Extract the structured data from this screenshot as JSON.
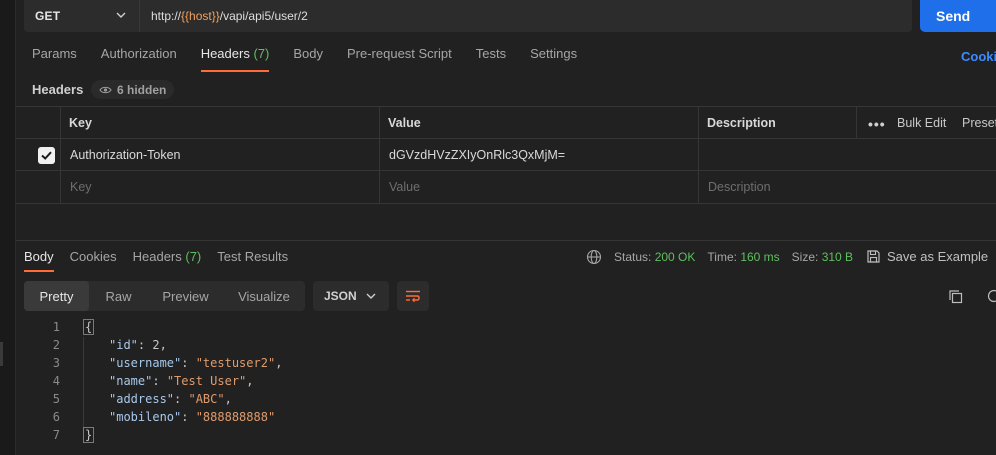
{
  "request": {
    "method": "GET",
    "url_prefix": "http://",
    "url_variable": "{{host}}",
    "url_suffix": "/vapi/api5/user/2",
    "send_label": "Send"
  },
  "request_tabs": [
    {
      "label": "Params"
    },
    {
      "label": "Authorization"
    },
    {
      "label": "Headers",
      "count": "(7)",
      "active": true
    },
    {
      "label": "Body"
    },
    {
      "label": "Pre-request Script"
    },
    {
      "label": "Tests"
    },
    {
      "label": "Settings"
    }
  ],
  "cookies_link": "Cooki",
  "headers_section": {
    "title": "Headers",
    "hidden_label": "6 hidden"
  },
  "headers_table": {
    "columns": [
      "Key",
      "Value",
      "Description"
    ],
    "bulk_edit": "Bulk Edit",
    "presets": "Preset",
    "rows": [
      {
        "checked": true,
        "key": "Authorization-Token",
        "value": "dGVzdHVzZXIyOnRlc3QxMjM=",
        "description": ""
      }
    ],
    "placeholder": {
      "key": "Key",
      "value": "Value",
      "description": "Description"
    }
  },
  "response_tabs": [
    {
      "label": "Body",
      "active": true
    },
    {
      "label": "Cookies"
    },
    {
      "label": "Headers",
      "count": "(7)"
    },
    {
      "label": "Test Results"
    }
  ],
  "response_status": {
    "status_label": "Status:",
    "status_value": "200 OK",
    "time_label": "Time:",
    "time_value": "160 ms",
    "size_label": "Size:",
    "size_value": "310 B",
    "save_example": "Save as Example"
  },
  "view_modes": [
    {
      "label": "Pretty",
      "active": true
    },
    {
      "label": "Raw"
    },
    {
      "label": "Preview"
    },
    {
      "label": "Visualize"
    }
  ],
  "format_select": "JSON",
  "code_lines": [
    {
      "num": "1",
      "text": "{"
    },
    {
      "num": "2",
      "key": "\"id\"",
      "sep": ": ",
      "value": "2",
      "type": "number",
      "trail": ","
    },
    {
      "num": "3",
      "key": "\"username\"",
      "sep": ": ",
      "value": "\"testuser2\"",
      "type": "string",
      "trail": ","
    },
    {
      "num": "4",
      "key": "\"name\"",
      "sep": ": ",
      "value": "\"Test User\"",
      "type": "string",
      "trail": ","
    },
    {
      "num": "5",
      "key": "\"address\"",
      "sep": ": ",
      "value": "\"ABC\"",
      "type": "string",
      "trail": ","
    },
    {
      "num": "6",
      "key": "\"mobileno\"",
      "sep": ": ",
      "value": "\"888888888\"",
      "type": "string",
      "trail": ""
    },
    {
      "num": "7",
      "text": "}"
    }
  ],
  "colors": {
    "accent": "#ff6c37",
    "send": "#1f6feb",
    "status_green": "#5fbf5f",
    "url_variable": "#f3a05c",
    "json_string": "#e09b6c"
  }
}
